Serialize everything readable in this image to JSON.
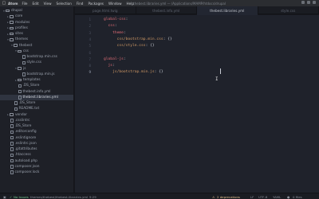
{
  "menubar": {
    "app_name": "Atom",
    "items": [
      "File",
      "Edit",
      "View",
      "Selection",
      "Find",
      "Packages",
      "Window",
      "Help"
    ],
    "window_title": "thebest.libraries.yml — /Applications/MAMP/htdocs/drupal"
  },
  "sidebar": {
    "items": [
      {
        "label": "drupal",
        "type": "folder",
        "depth": 0,
        "expanded": true
      },
      {
        "label": "core",
        "type": "folder",
        "depth": 1
      },
      {
        "label": "modules",
        "type": "folder",
        "depth": 1
      },
      {
        "label": "profiles",
        "type": "folder",
        "depth": 1
      },
      {
        "label": "sites",
        "type": "folder",
        "depth": 1
      },
      {
        "label": "themes",
        "type": "folder",
        "depth": 1,
        "expanded": true
      },
      {
        "label": "thebest",
        "type": "folder",
        "depth": 2,
        "expanded": true
      },
      {
        "label": "css",
        "type": "folder",
        "depth": 3,
        "expanded": true
      },
      {
        "label": "bootstrap.min.css",
        "type": "file",
        "depth": 4
      },
      {
        "label": "style.css",
        "type": "file",
        "depth": 4
      },
      {
        "label": "js",
        "type": "folder",
        "depth": 3,
        "expanded": true
      },
      {
        "label": "bootstrap.min.js",
        "type": "file",
        "depth": 4
      },
      {
        "label": "templates",
        "type": "folder",
        "depth": 3
      },
      {
        "label": ".DS_Store",
        "type": "file",
        "depth": 3
      },
      {
        "label": "thebest.info.yml",
        "type": "file",
        "depth": 3
      },
      {
        "label": "thebest.libraries.yml",
        "type": "file",
        "depth": 3,
        "selected": true
      },
      {
        "label": ".DS_Store",
        "type": "file",
        "depth": 2
      },
      {
        "label": "README.txt",
        "type": "file",
        "depth": 2
      },
      {
        "label": "vendor",
        "type": "folder",
        "depth": 1
      },
      {
        "label": ".csslintrc",
        "type": "file",
        "depth": 1
      },
      {
        "label": ".DS_Store",
        "type": "file",
        "depth": 1
      },
      {
        "label": ".editorconfig",
        "type": "file",
        "depth": 1
      },
      {
        "label": ".eslintignore",
        "type": "file",
        "depth": 1
      },
      {
        "label": ".eslintrc.json",
        "type": "file",
        "depth": 1
      },
      {
        "label": ".gitattributes",
        "type": "file",
        "depth": 1
      },
      {
        "label": ".htaccess",
        "type": "file",
        "depth": 1
      },
      {
        "label": "autoload.php",
        "type": "file",
        "depth": 1
      },
      {
        "label": "composer.json",
        "type": "file",
        "depth": 1
      },
      {
        "label": "composer.lock",
        "type": "file",
        "depth": 1
      }
    ]
  },
  "tabs": [
    {
      "label": "page.html.twig",
      "active": false
    },
    {
      "label": "thebest.info.yml",
      "active": false
    },
    {
      "label": "thebest.libraries.yml",
      "active": true
    },
    {
      "label": "style.css",
      "active": false
    }
  ],
  "editor": {
    "line_numbers": [
      "1",
      "2",
      "3",
      "4",
      "5",
      "6",
      "7",
      "8",
      "9"
    ],
    "current_line": 9,
    "lines": [
      [
        {
          "t": "global-css",
          "c": "k"
        },
        {
          "t": ":",
          "c": "p"
        }
      ],
      [
        {
          "t": "  css",
          "c": "k"
        },
        {
          "t": ":",
          "c": "p"
        }
      ],
      [
        {
          "t": "    theme",
          "c": "k"
        },
        {
          "t": ":",
          "c": "p"
        }
      ],
      [
        {
          "t": "      css/bootstrap.min.css",
          "c": "s"
        },
        {
          "t": ": {}",
          "c": "p"
        }
      ],
      [
        {
          "t": "      css/style.css",
          "c": "s"
        },
        {
          "t": ": {}",
          "c": "p"
        }
      ],
      [],
      [
        {
          "t": "global-js",
          "c": "k"
        },
        {
          "t": ":",
          "c": "p"
        }
      ],
      [
        {
          "t": "  js",
          "c": "k"
        },
        {
          "t": ":",
          "c": "p"
        }
      ],
      [
        {
          "t": "    js/bootstrap.min.js",
          "c": "s"
        },
        {
          "t": ": {}",
          "c": "p"
        }
      ]
    ]
  },
  "statusbar": {
    "file_path": "themes/thebest/thebest.libraries.yml",
    "position": "9:29",
    "issues_label": "No Issues",
    "deprecations": "2 deprecations",
    "line_ending": "LF",
    "encoding": "UTF-8",
    "grammar": "YAML",
    "files_label": "0 files"
  },
  "colors": {
    "editor_bg": "#1f222b",
    "sidebar_bg": "#1e2027",
    "keyword": "#e06c75",
    "string": "#d19a66",
    "ok": "#73c990",
    "warning": "#e2c08d"
  }
}
